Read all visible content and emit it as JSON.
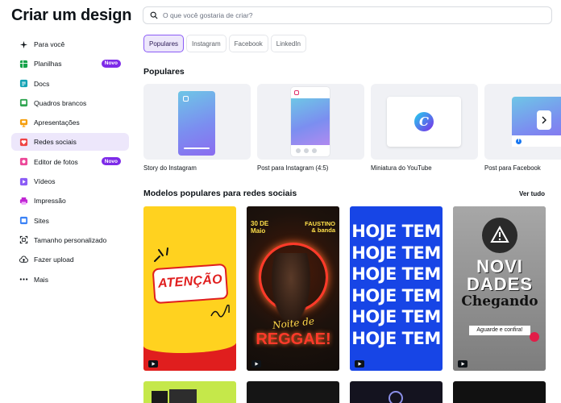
{
  "app": {
    "title": "Criar um design"
  },
  "search": {
    "placeholder": "O que você gostaria de criar?"
  },
  "sidebar": {
    "items": [
      {
        "label": "Para você",
        "icon": "sparkle-icon",
        "active": false
      },
      {
        "label": "Planilhas",
        "icon": "spreadsheet-icon",
        "badge": "Novo"
      },
      {
        "label": "Docs",
        "icon": "docs-icon"
      },
      {
        "label": "Quadros brancos",
        "icon": "whiteboard-icon"
      },
      {
        "label": "Apresentações",
        "icon": "presentation-icon"
      },
      {
        "label": "Redes sociais",
        "icon": "heart-icon",
        "active": true
      },
      {
        "label": "Editor de fotos",
        "icon": "photo-editor-icon",
        "badge": "Novo"
      },
      {
        "label": "Vídeos",
        "icon": "video-icon"
      },
      {
        "label": "Impressão",
        "icon": "print-icon"
      },
      {
        "label": "Sites",
        "icon": "website-icon"
      },
      {
        "label": "Tamanho personalizado",
        "icon": "resize-icon"
      },
      {
        "label": "Fazer upload",
        "icon": "upload-icon"
      },
      {
        "label": "Mais",
        "icon": "more-icon"
      }
    ]
  },
  "tabs": [
    {
      "label": "Populares",
      "active": true
    },
    {
      "label": "Instagram"
    },
    {
      "label": "Facebook"
    },
    {
      "label": "LinkedIn"
    }
  ],
  "popular": {
    "title": "Populares",
    "cards": [
      {
        "label": "Story do Instagram"
      },
      {
        "label": "Post para Instagram (4:5)"
      },
      {
        "label": "Miniatura do YouTube"
      },
      {
        "label": "Post para Facebook"
      }
    ]
  },
  "templates": {
    "title": "Modelos populares para redes sociais",
    "see_all": "Ver tudo",
    "cards": [
      {
        "text": "ATENÇÃO"
      },
      {
        "top_left": "30 DE\nMaio",
        "top_right": "FAUSTINO\n& banda",
        "script": "Noite de",
        "main": "REGGAE!"
      },
      {
        "line": "HOJE TEM",
        "repeat": 6
      },
      {
        "top": "Novidades",
        "line1": "NOVI",
        "line2": "DADES",
        "line3": "Chegando",
        "cta": "Aguarde e confira!"
      }
    ]
  },
  "colors": {
    "accent": "#7d2ae8",
    "active_bg": "#ede7fb",
    "card_bg": "#f0f1f5"
  }
}
